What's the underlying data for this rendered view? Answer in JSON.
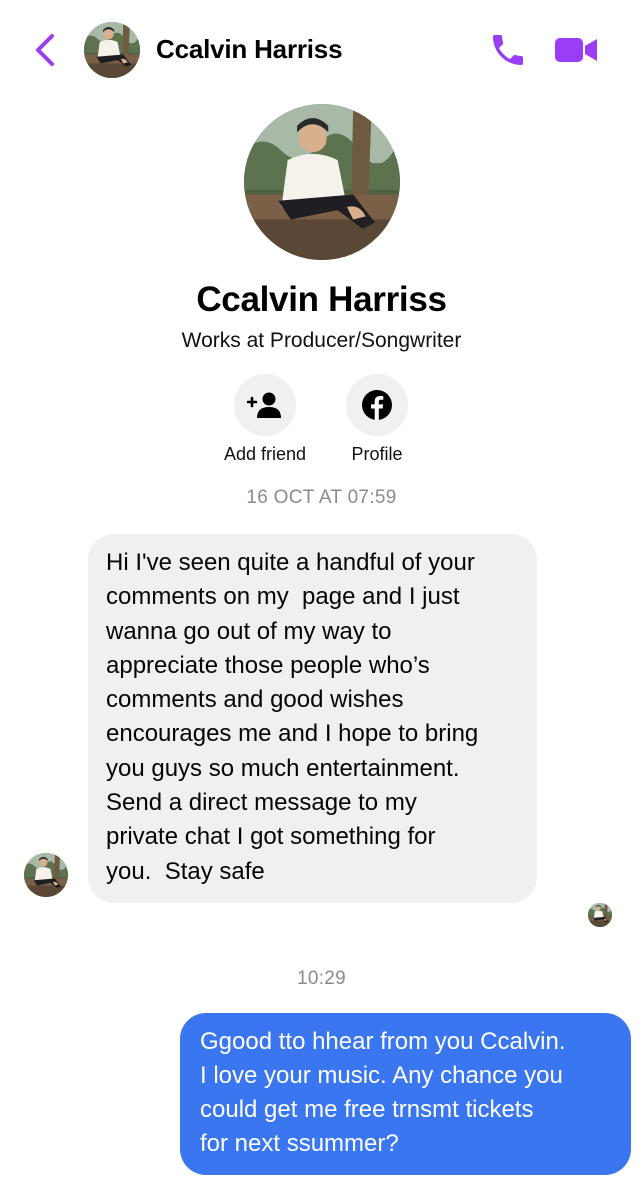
{
  "header": {
    "contact_name": "Ccalvin Harriss",
    "back_icon": "chevron-left-icon",
    "call_icon": "phone-icon",
    "video_icon": "video-camera-icon",
    "accent_color": "#9b3df5"
  },
  "profile": {
    "name": "Ccalvin Harriss",
    "subtitle": "Works at Producer/Songwriter",
    "actions": [
      {
        "label": "Add friend",
        "icon": "add-person-icon"
      },
      {
        "label": "Profile",
        "icon": "facebook-icon"
      }
    ]
  },
  "conversation": {
    "timestamps": [
      "16 OCT AT 07:59",
      "10:29"
    ],
    "messages": [
      {
        "direction": "incoming",
        "lines": [
          "Hi I've seen quite a handful of your",
          "comments on my  page and I just",
          "wanna go out of my way to",
          "appreciate those people who’s",
          "comments and good wishes",
          "encourages me and I hope to bring",
          "you guys so much entertainment.",
          "Send a direct message to my",
          "private chat I got something for",
          "you.  Stay safe"
        ],
        "bubble_color": "#f0f0f0"
      },
      {
        "direction": "outgoing",
        "lines": [
          "Ggood tto hhear from you Ccalvin.",
          "I love your music. Any chance you",
          "could get me free trnsmt tickets",
          "for next ssummer?"
        ],
        "bubble_color": "#3a76f0"
      }
    ]
  }
}
